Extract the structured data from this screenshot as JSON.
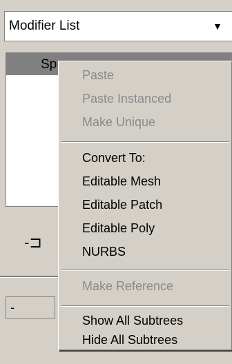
{
  "modifier_list": {
    "label": "Modifier List",
    "arrow": "▼"
  },
  "stack": {
    "selected_item": "Sp"
  },
  "toolbar": {
    "pin_icon": "-⊐"
  },
  "param": {
    "value": "-"
  },
  "context_menu": {
    "items": [
      {
        "label": "Paste",
        "enabled": false
      },
      {
        "label": "Paste Instanced",
        "enabled": false
      },
      {
        "label": "Make Unique",
        "enabled": false
      },
      {
        "label": "Convert To:",
        "enabled": true
      },
      {
        "label": "Editable Mesh",
        "enabled": true
      },
      {
        "label": "Editable Patch",
        "enabled": true
      },
      {
        "label": "Editable Poly",
        "enabled": true
      },
      {
        "label": "NURBS",
        "enabled": true
      },
      {
        "label": "Make Reference",
        "enabled": false
      },
      {
        "label": "Show All Subtrees",
        "enabled": true
      },
      {
        "label": "Hide All Subtrees",
        "enabled": true
      }
    ]
  }
}
